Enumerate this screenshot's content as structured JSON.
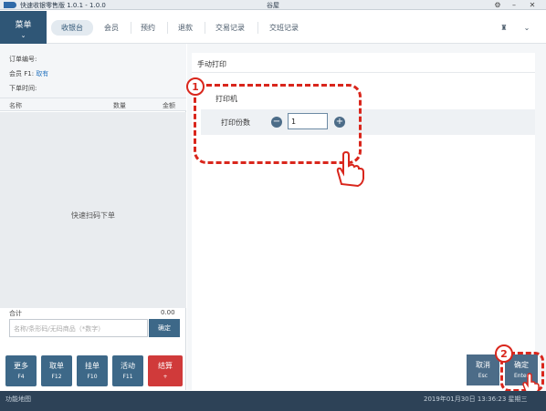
{
  "app": {
    "title": "快速收银零售版 1.0.1 - 1.0.0",
    "center_title": "谷屋",
    "window_controls": [
      "gear-icon",
      "minimize-icon",
      "close-icon"
    ]
  },
  "menu": {
    "label": "菜单",
    "chevron": "⌄"
  },
  "nav": {
    "tabs": [
      {
        "label": "收银台"
      },
      {
        "label": "会员"
      },
      {
        "label": "预约"
      },
      {
        "label": "退款"
      },
      {
        "label": "交易记录"
      },
      {
        "label": "交班记录"
      }
    ],
    "active_index": 0
  },
  "order": {
    "order_no_label": "订单编号:",
    "member_label": "会员",
    "member_key": "F1:",
    "member_link": "取有",
    "time_label": "下单时间:"
  },
  "list": {
    "columns": [
      "名称",
      "数量",
      "金额"
    ],
    "empty_hint": "快速扫码下单",
    "total_label": "合计",
    "total_value": "0.00"
  },
  "search": {
    "placeholder": "名称/条形码/无码商品（*数字）",
    "confirm_label": "确定"
  },
  "function_buttons": [
    {
      "label": "更多",
      "key": "F4"
    },
    {
      "label": "取单",
      "key": "F12"
    },
    {
      "label": "挂单",
      "key": "F10"
    },
    {
      "label": "活动",
      "key": "F11"
    },
    {
      "label": "结算",
      "key": "+"
    }
  ],
  "print": {
    "section_title": "手动打印",
    "printer_label": "打印机",
    "copies_label": "打印份数",
    "copies_value": "1"
  },
  "actions": {
    "cancel": {
      "label": "取消",
      "key": "Esc"
    },
    "confirm": {
      "label": "确定",
      "key": "Enter"
    }
  },
  "annotations": {
    "step1": "1",
    "step2": "2"
  },
  "status": {
    "left": "功能地图",
    "right": "2019年01月30日 13:36:23 星期三"
  },
  "colors": {
    "primary": "#3d6888",
    "danger": "#d03a3a",
    "annotation": "#d9261c",
    "statusbar": "#2d4257"
  }
}
